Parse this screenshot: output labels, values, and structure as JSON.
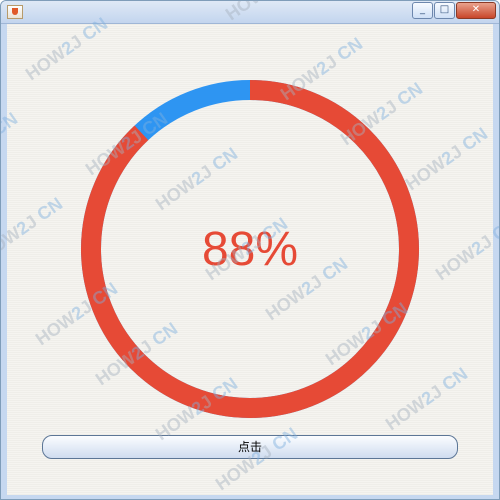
{
  "window": {
    "controls": {
      "minimize": "_",
      "maximize": "□",
      "close": "✕"
    }
  },
  "progress": {
    "value": 88,
    "label": "88%",
    "colors": {
      "filled": "#e64a36",
      "remaining": "#2e95f2"
    }
  },
  "button": {
    "label": "点击"
  },
  "watermark": {
    "text_main": "HOW",
    "text_mid": "2",
    "text_end": "J",
    "text_suffix": "CN"
  }
}
